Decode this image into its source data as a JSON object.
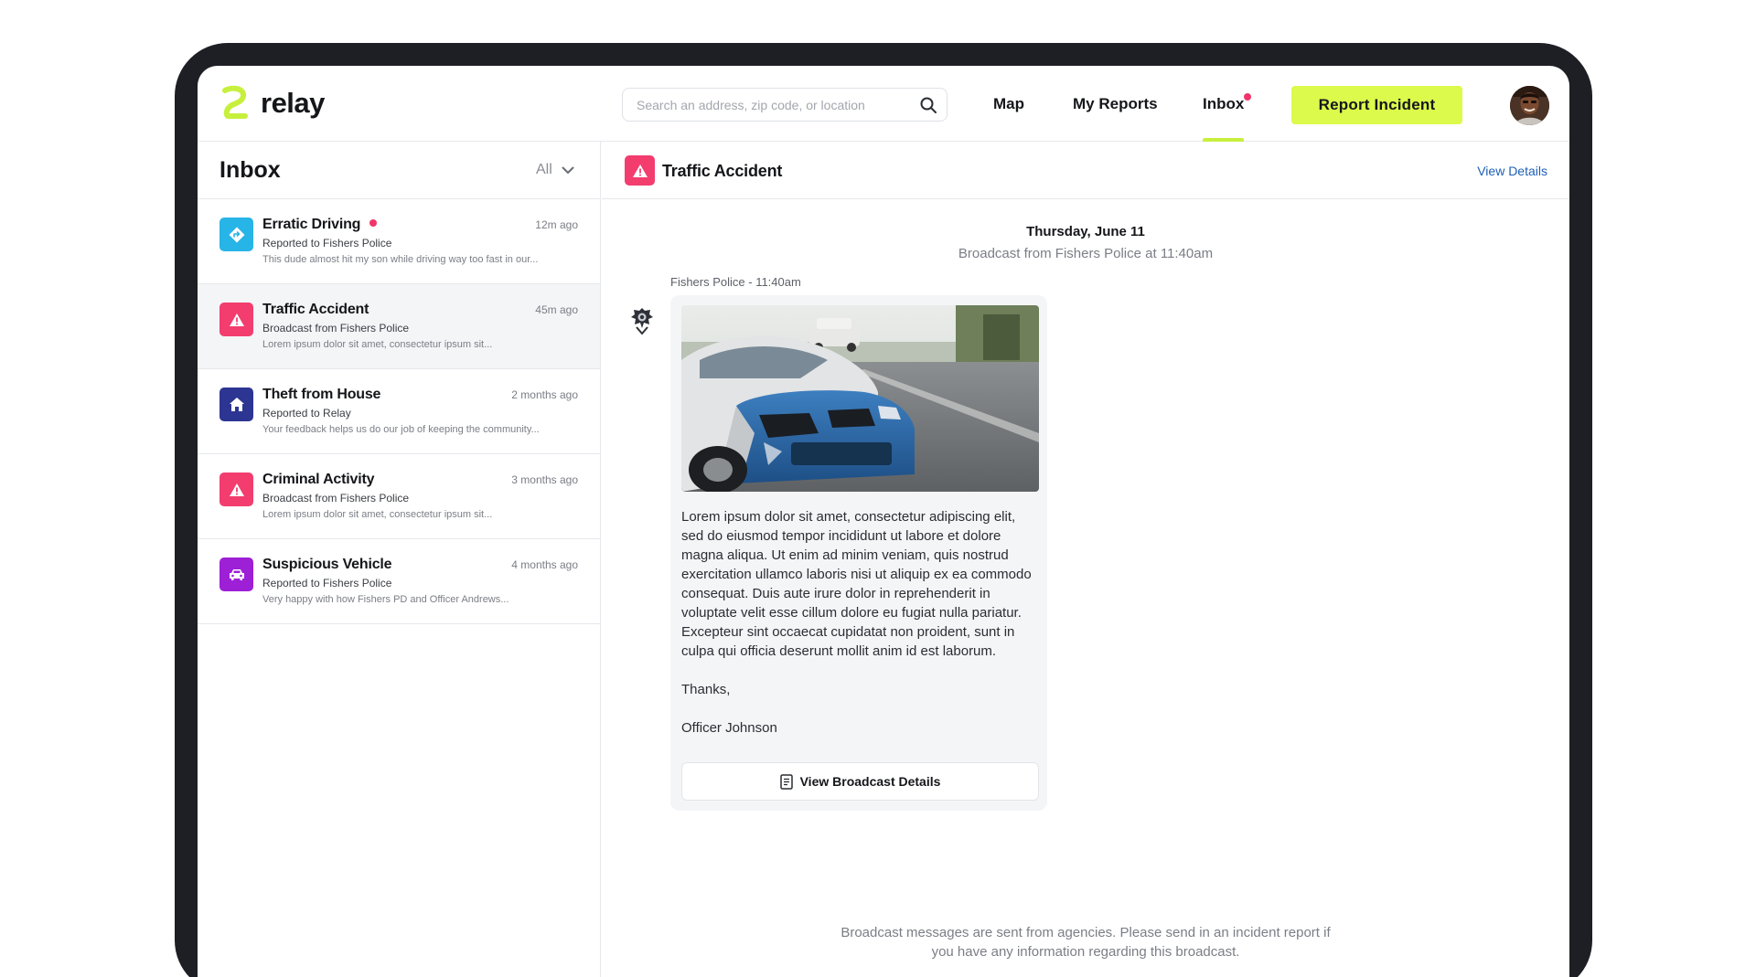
{
  "app": {
    "name": "relay"
  },
  "header": {
    "search_placeholder": "Search an address, zip code, or location",
    "nav": {
      "map": "Map",
      "reports": "My Reports",
      "inbox": "Inbox"
    },
    "report_button": "Report Incident"
  },
  "inbox": {
    "title": "Inbox",
    "filter": "All",
    "items": [
      {
        "title": "Erratic Driving",
        "time": "12m ago",
        "sub": "Reported to Fishers Police",
        "preview": "This dude almost hit my son while driving way too fast in our...",
        "icon": "road-sign-icon",
        "color": "#27b4e6",
        "unread": true
      },
      {
        "title": "Traffic Accident",
        "time": "45m ago",
        "sub": "Broadcast from Fishers Police",
        "preview": "Lorem ipsum dolor sit amet, consectetur ipsum sit...",
        "icon": "warning-icon",
        "color": "#f23d6e",
        "unread": false
      },
      {
        "title": "Theft from House",
        "time": "2 months ago",
        "sub": "Reported to Relay",
        "preview": "Your feedback helps us do our job of keeping the community...",
        "icon": "house-icon",
        "color": "#2d3593",
        "unread": false
      },
      {
        "title": "Criminal Activity",
        "time": "3 months ago",
        "sub": "Broadcast from Fishers Police",
        "preview": "Lorem ipsum dolor sit amet, consectetur ipsum sit...",
        "icon": "warning-icon",
        "color": "#f23d6e",
        "unread": false
      },
      {
        "title": "Suspicious Vehicle",
        "time": "4 months ago",
        "sub": "Reported to Fishers Police",
        "preview": "Very happy with how Fishers PD and Officer Andrews...",
        "icon": "car-icon",
        "color": "#9d1fd6",
        "unread": false
      }
    ]
  },
  "detail": {
    "title": "Traffic Accident",
    "view_details": "View Details",
    "date": "Thursday, June 11",
    "broadcast_line": "Broadcast from Fishers Police at 11:40am",
    "sender": "Fishers Police - 11:40am",
    "message": {
      "body": "Lorem ipsum dolor sit amet, consectetur adipiscing elit, sed do eiusmod tempor incididunt ut labore et dolore magna aliqua. Ut enim ad minim veniam, quis nostrud exercitation ullamco laboris nisi ut aliquip ex ea commodo consequat. Duis aute irure dolor in reprehenderit in voluptate velit esse cillum dolore eu fugiat nulla pariatur. Excepteur sint occaecat cupidatat non proident, sunt in culpa qui officia deserunt mollit anim id est laborum.",
      "thanks": "Thanks,",
      "signature": "Officer Johnson"
    },
    "broadcast_button": "View Broadcast Details",
    "footnote": "Broadcast messages are sent from agencies. Please send in an incident report if you have any information regarding this broadcast."
  },
  "colors": {
    "accent": "#dcfa4b",
    "unread": "#f0356b",
    "link": "#1e5fb6"
  }
}
